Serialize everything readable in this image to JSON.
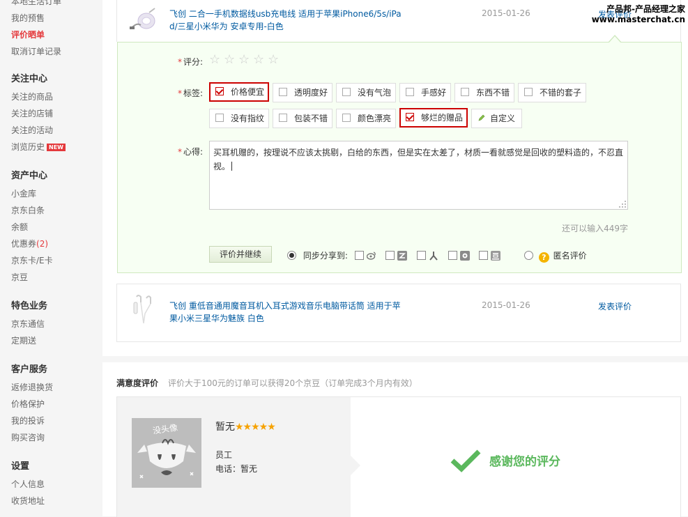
{
  "sidebar": {
    "top_items": [
      "本地生活订单",
      "我的预售",
      "评价晒单",
      "取消订单记录"
    ],
    "follow": {
      "heading": "关注中心",
      "items": [
        "关注的商品",
        "关注的店铺",
        "关注的活动",
        "浏览历史"
      ],
      "new_badge": "NEW"
    },
    "assets": {
      "heading": "资产中心",
      "items": [
        "小金库",
        "京东白条",
        "余额",
        "优惠券",
        "京东卡/E卡",
        "京豆"
      ],
      "coupon_count": "(2)"
    },
    "special": {
      "heading": "特色业务",
      "items": [
        "京东通信",
        "定期送"
      ]
    },
    "service": {
      "heading": "客户服务",
      "items": [
        "返修退换货",
        "价格保护",
        "我的投诉",
        "购买咨询"
      ]
    },
    "settings": {
      "heading": "设置",
      "items": [
        "个人信息",
        "收货地址"
      ]
    }
  },
  "products": [
    {
      "title_line1": "飞创 二合一手机数据线usb充电线 适用于苹果iPhone6/5s/iPa",
      "title_line2": "d/三星小米华为 安卓专用-白色",
      "date": "2015-01-26",
      "action": "发表评价"
    },
    {
      "title_line1": "飞创 重低音通用魔音耳机入耳式游戏音乐电脑带话筒 适用于苹",
      "title_line2": "果小米三星华为魅族 白色",
      "date": "2015-01-26",
      "action": "发表评价"
    }
  ],
  "review": {
    "required_mark": "*",
    "score_label": "评分:",
    "tags_label": "标签:",
    "comment_label": "心得:",
    "tags_row1": [
      {
        "label": "价格便宜",
        "checked": true
      },
      {
        "label": "透明度好",
        "checked": false
      },
      {
        "label": "没有气泡",
        "checked": false
      },
      {
        "label": "手感好",
        "checked": false
      },
      {
        "label": "东西不错",
        "checked": false
      },
      {
        "label": "不错的套子",
        "checked": false
      }
    ],
    "tags_row2": [
      {
        "label": "没有指纹",
        "checked": false
      },
      {
        "label": "包装不错",
        "checked": false
      },
      {
        "label": "颜色漂亮",
        "checked": false
      },
      {
        "label": "够烂的赠品",
        "checked": true
      }
    ],
    "custom_tag": "自定义",
    "comment_text": "买耳机赠的，按理说不应该太挑剔，白给的东西，但是实在太差了，材质一看就感觉是回收的塑料造的，不忍直视。",
    "remaining": "还可以输入449字",
    "submit": "评价并继续",
    "share_label": "同步分享到:",
    "anonymous_label": "匿名评价"
  },
  "satisfaction": {
    "title": "满意度评价",
    "note": "评价大于100元的订单可以获得20个京豆（订单完成3个月内有效）",
    "avatar_text": "没头像",
    "employee_name": "暂无",
    "stars": "★★★★★",
    "role": "员工",
    "phone": "电话：暂无",
    "thanks": "感谢您的评分"
  },
  "watermark": {
    "line1": "产品邦-产品经理之家",
    "line2": "www.masterchat.cn"
  },
  "colors": {
    "accent_red": "#e4393c",
    "link_blue": "#005aa0",
    "review_bg": "#f7fff3",
    "success_green": "#5bb85d",
    "star_yellow": "#f6a200"
  }
}
